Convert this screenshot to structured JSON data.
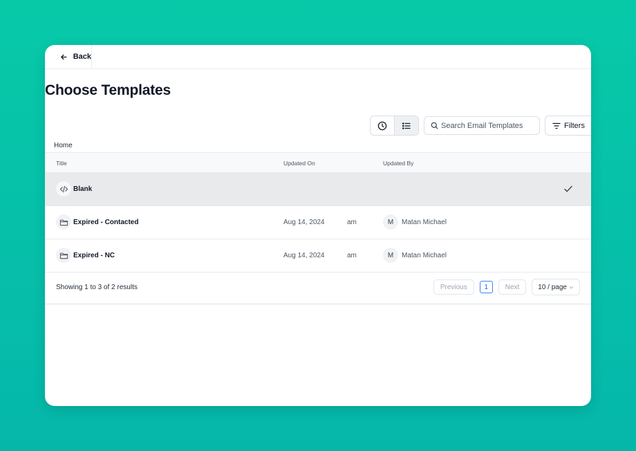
{
  "topbar": {
    "back_label": "Back"
  },
  "page": {
    "title": "Choose Templates"
  },
  "toolbar": {
    "search_placeholder": "Search Email Templates",
    "filters_label": "Filters"
  },
  "breadcrumb": "Home",
  "table": {
    "columns": {
      "title": "Title",
      "updated_on": "Updated On",
      "updated_by": "Updated By"
    },
    "rows": [
      {
        "title": "Blank",
        "date": "",
        "time": "",
        "avatar": "",
        "user": "",
        "selected": true
      },
      {
        "title": "Expired - Contacted",
        "date": "Aug 14, 2024",
        "time": "am",
        "avatar": "M",
        "user": "Matan Michael",
        "selected": false
      },
      {
        "title": "Expired - NC",
        "date": "Aug 14, 2024",
        "time": "am",
        "avatar": "M",
        "user": "Matan Michael",
        "selected": false
      }
    ]
  },
  "pagination": {
    "summary": "Showing 1 to 3 of 2 results",
    "previous": "Previous",
    "current_page": "1",
    "next": "Next",
    "page_size": "10 / page"
  },
  "colors": {
    "background": "#07c9a8",
    "accent": "#2563eb",
    "selected_row": "#e9eaec"
  }
}
